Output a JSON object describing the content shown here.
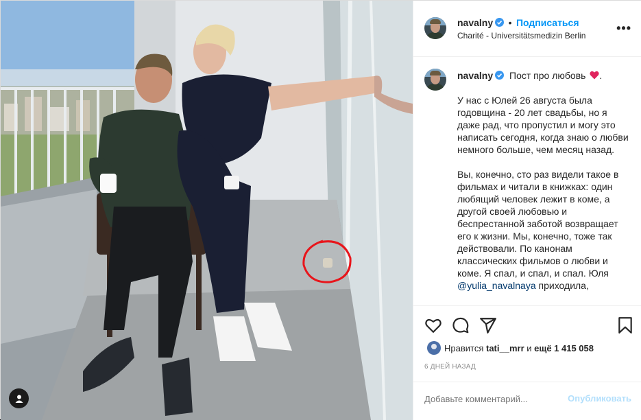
{
  "post": {
    "username": "navalny",
    "follow_label": "Подписаться",
    "location": "Charité - Universitätsmedizin Berlin",
    "more_label": "•••"
  },
  "caption": {
    "username": "navalny",
    "title": "Пост про любовь",
    "paragraph1": "У нас с Юлей 26 августа была годовщина - 20 лет свадьбы, но я даже рад, что пропустил и могу это написать сегодня, когда знаю о любви немного больше, чем месяц назад.",
    "paragraph2": "Вы, конечно, сто раз видели такое в фильмах и читали в книжках: один любящий человек лежит в коме, а другой своей любовью и беспрестанной заботой возвращает его к жизни. Мы, конечно, тоже так действовали. По канонам классических фильмов о любви и коме. Я спал, и спал, и спал. Юля",
    "mention": "@yulia_navalnaya",
    "paragraph2_tail": " приходила,"
  },
  "likes": {
    "prefix": "Нравится ",
    "user": "tati__mrr",
    "middle": " и ",
    "count": "ещё 1 415 058"
  },
  "time": "6 ДНЕЙ НАЗАД",
  "comment": {
    "placeholder": "Добавьте комментарий...",
    "publish_label": "Опубликовать"
  },
  "colors": {
    "accent": "#0095f6",
    "verified": "#3897f0",
    "heart": "#e0245e",
    "annotation_circle": "#e8151b"
  }
}
